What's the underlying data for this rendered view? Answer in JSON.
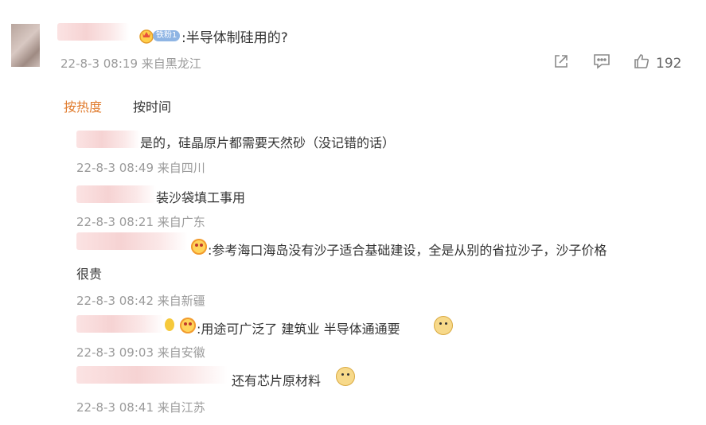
{
  "post": {
    "text": ":半导体制硅用的?",
    "badge": "铁粉1",
    "time": "22-8-3 08:19 来自黑龙江",
    "like_count": "192",
    "icons": [
      "share-icon",
      "comment-icon",
      "like-icon"
    ]
  },
  "tabs": {
    "hot": "按热度",
    "time": "按时间"
  },
  "comments": [
    {
      "text": "是的，硅晶原片都需要天然砂（没记错的话）",
      "time": "22-8-3 08:49 来自四川"
    },
    {
      "text": "装沙袋填工事用",
      "time": "22-8-3 08:21 来自广东"
    },
    {
      "text": ":参考海口海岛没有沙子适合基础建设，全是从别的省拉沙子，沙子价格",
      "text2": "很贵",
      "time": "22-8-3 08:42 来自新疆"
    },
    {
      "text": ":用途可广泛了 建筑业 半导体通通要",
      "time": "22-8-3 09:03 来自安徽"
    },
    {
      "text": "还有芯片原材料",
      "time": "22-8-3 08:41 来自江苏"
    }
  ],
  "colors": {
    "accent": "#f08c2e",
    "meta": "#9b9b9b",
    "text": "#333333"
  }
}
